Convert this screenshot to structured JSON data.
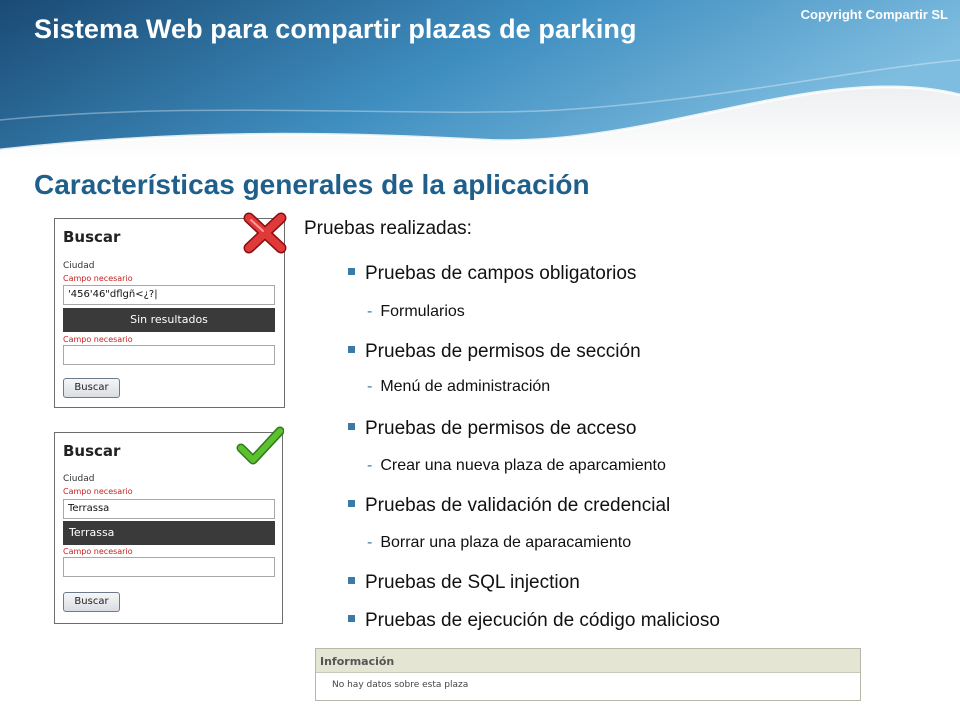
{
  "header": {
    "title": "Sistema Web para compartir plazas de parking",
    "copyright": "Copyright Compartir SL",
    "colors": {
      "band_dark": "#1a4f7a",
      "band_light": "#5fa5cf",
      "section_title": "#1f5f8b"
    }
  },
  "section_title": "Características generales de la aplicación",
  "panel_fail": {
    "title": "Buscar",
    "city_label": "Ciudad",
    "required_1": "Campo necesario",
    "input_value": "'456'46\"dflgñ<¿?|",
    "result_text": "Sin resultados",
    "required_2": "Campo necesario",
    "button_label": "Buscar",
    "status_icon": "red-x-cross-icon"
  },
  "panel_pass": {
    "title": "Buscar",
    "city_label": "Ciudad",
    "required_1": "Campo necesario",
    "input_value": "Terrassa",
    "result_text": "Terrassa",
    "required_2": "Campo necesario",
    "button_label": "Buscar",
    "status_icon": "green-checkmark-icon"
  },
  "tests": {
    "heading": "Pruebas realizadas:",
    "items": [
      {
        "label": "Pruebas de campos obligatorios",
        "sub": "Formularios"
      },
      {
        "label": "Pruebas de permisos de sección",
        "sub": "Menú de administración"
      },
      {
        "label": "Pruebas de permisos de acceso",
        "sub": "Crear una nueva plaza de aparcamiento"
      },
      {
        "label": "Pruebas de validación de credencial",
        "sub": "Borrar una plaza de aparacamiento"
      },
      {
        "label": "Pruebas de SQL injection"
      },
      {
        "label": "Pruebas de ejecución de código malicioso"
      }
    ]
  },
  "info_box": {
    "title": "Información",
    "text": "No hay datos sobre esta plaza"
  }
}
